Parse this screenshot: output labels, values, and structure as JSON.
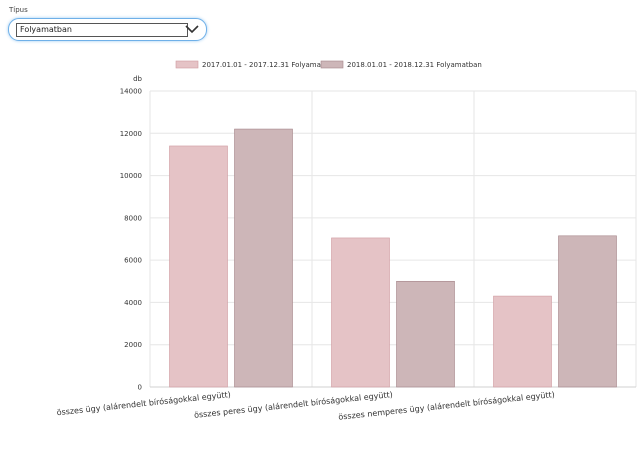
{
  "filter": {
    "label": "Típus",
    "selected": "Folyamatban"
  },
  "colors": {
    "series1": "#e5c3c6",
    "series1_border": "#cf9aa0",
    "series2": "#cdb6b8",
    "series2_border": "#a48488",
    "select_border": "#6fb0e8"
  },
  "chart_data": {
    "type": "bar",
    "ylabel": "db",
    "ylim": [
      0,
      14000
    ],
    "yticks": [
      0,
      2000,
      4000,
      6000,
      8000,
      10000,
      12000,
      14000
    ],
    "categories": [
      "összes ügy (alárendelt bíróságokkal együtt)",
      "összes peres ügy (alárendelt bíróságokkal együtt)",
      "összes nemperes ügy (alárendelt bíróságokkal együtt)"
    ],
    "series": [
      {
        "name": "2017.01.01 - 2017.12.31 Folyamatban",
        "values": [
          11400,
          7050,
          4300
        ]
      },
      {
        "name": "2018.01.01 - 2018.12.31 Folyamatban",
        "values": [
          12200,
          5000,
          7150
        ]
      }
    ],
    "grid": true,
    "legend": "top-center"
  }
}
